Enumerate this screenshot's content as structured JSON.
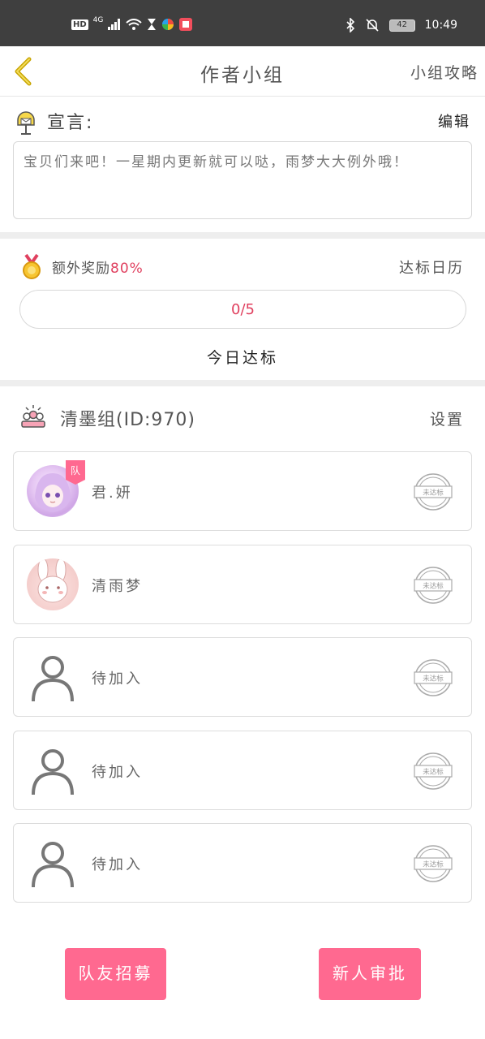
{
  "status_bar": {
    "hd": "HD",
    "network": "4G",
    "battery": "42",
    "time": "10:49",
    "icons": [
      "hd-icon",
      "signal-icon",
      "wifi-icon",
      "hourglass-icon",
      "app-icon",
      "book-icon",
      "bluetooth-icon",
      "mute-bell-icon",
      "battery-icon"
    ]
  },
  "header": {
    "title": "作者小组",
    "guide_label": "小组攻略",
    "back_icon": "chevron-left-icon"
  },
  "declaration": {
    "label": "宣言:",
    "edit_label": "编辑",
    "text": "宝贝们来吧！一星期内更新就可以哒，雨梦大大例外哦！"
  },
  "reward": {
    "label": "额外奖励",
    "percent": "80%",
    "calendar_label": "达标日历",
    "progress_text": "0/5",
    "progress_fraction": 0,
    "today_label": "今日达标"
  },
  "group": {
    "name": "清墨组(ID:970)",
    "settings_label": "设置"
  },
  "members": [
    {
      "name": "君.妍",
      "avatar": "photo-girl",
      "is_leader": true,
      "leader_tag": "队",
      "stamp": "未达标"
    },
    {
      "name": "清雨梦",
      "avatar": "photo-bunny",
      "is_leader": false,
      "stamp": "未达标"
    },
    {
      "name": "待加入",
      "avatar": "empty-user-icon",
      "is_leader": false,
      "stamp": "未达标"
    },
    {
      "name": "待加入",
      "avatar": "empty-user-icon",
      "is_leader": false,
      "stamp": "未达标"
    },
    {
      "name": "待加入",
      "avatar": "empty-user-icon",
      "is_leader": false,
      "stamp": "未达标"
    }
  ],
  "buttons": {
    "recruit": "队友招募",
    "approve": "新人审批"
  },
  "colors": {
    "accent_pink": "#ff6990",
    "accent_red": "#e0405f",
    "back_arrow": "#c8a400",
    "statusbar": "#3f3f3f"
  }
}
